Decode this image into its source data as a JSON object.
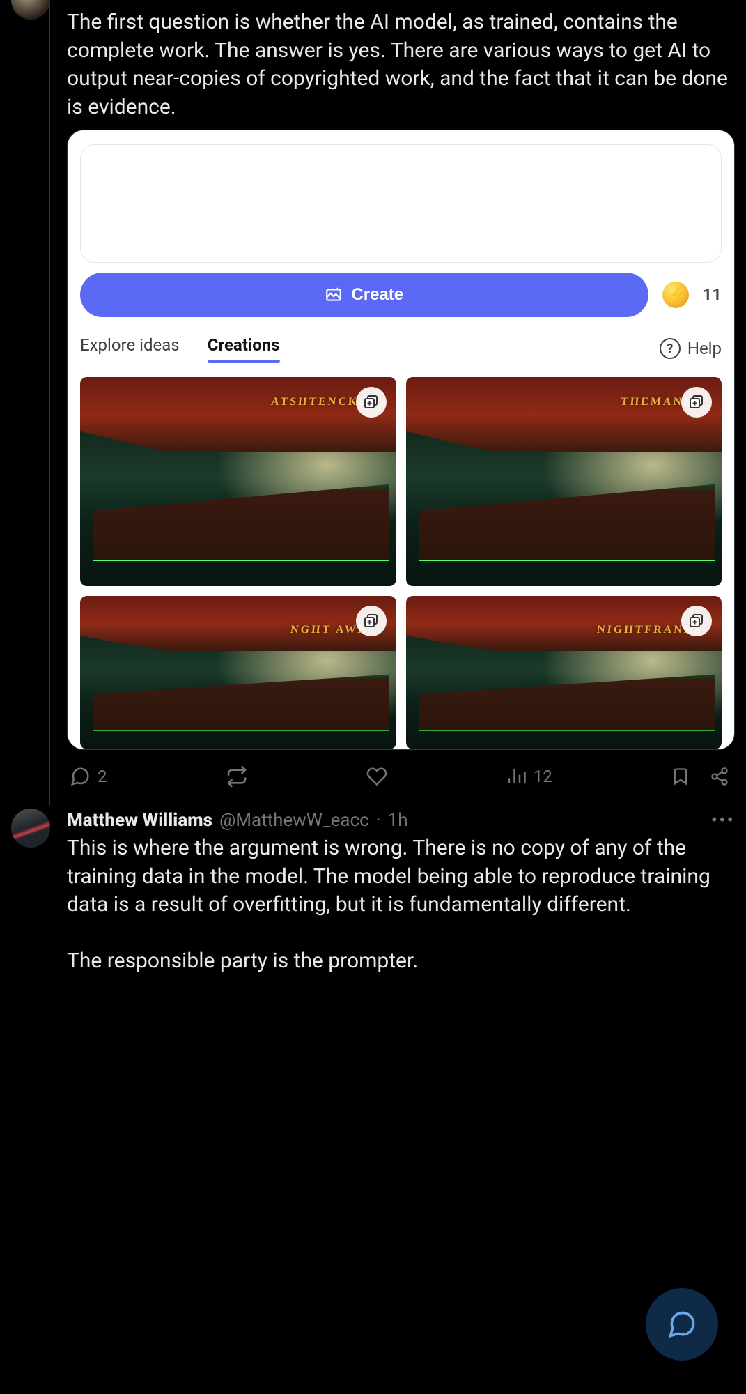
{
  "thread": {
    "tweets": [
      {
        "text": "The first question is whether the AI model, as trained, contains the complete work. The answer is yes. There are various ways to get AI to output near-copies of copyrighted work, and the fact that it can be done is evidence.",
        "actions": {
          "reply_count": "2",
          "views": "12"
        },
        "embed": {
          "create_label": "Create",
          "coin_count": "11",
          "tabs": {
            "explore": "Explore ideas",
            "creations": "Creations",
            "help": "Help"
          },
          "thumbs": [
            {
              "sign": "ATSHTENCKES"
            },
            {
              "sign": "THEMANKS"
            },
            {
              "sign": "NGHT AWKS"
            },
            {
              "sign": "NIGHTFRANKS"
            }
          ]
        }
      },
      {
        "author": {
          "name": "Matthew Williams",
          "handle": "@MatthewW_eacc",
          "time": "1h"
        },
        "text_p1": "This is where the argument is wrong. There is no copy of any of the training data in the model. The model being able to reproduce training data is a result of overfitting, but it is fundamentally different.",
        "text_p2": "The responsible party is the prompter."
      }
    ]
  }
}
